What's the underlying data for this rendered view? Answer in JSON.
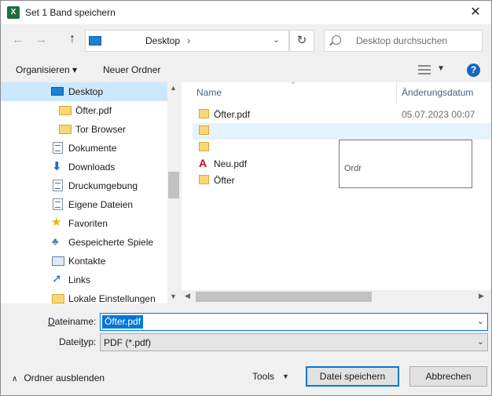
{
  "window": {
    "title": "Set 1 Band speichern",
    "app_icon_letter": "X",
    "close_glyph": "✕"
  },
  "nav": {
    "back_glyph": "←",
    "forward_glyph": "→",
    "up_glyph": "↑",
    "address": {
      "location": "Desktop",
      "separator": "›",
      "dropdown_glyph": "⌄"
    },
    "refresh_glyph": "↻",
    "search_placeholder": "Desktop durchsuchen"
  },
  "toolbar": {
    "organize": "Organisieren ▾",
    "new_folder": "Neuer Ordner",
    "view_dropdown": "▼",
    "help": "?"
  },
  "sidebar": {
    "items": [
      {
        "label": "Desktop",
        "icon": "desktop-icon",
        "selected": true
      },
      {
        "label": "Öfter.pdf",
        "icon": "folder-icon"
      },
      {
        "label": "Tor Browser",
        "icon": "folder-icon"
      },
      {
        "label": "Dokumente",
        "icon": "document-icon"
      },
      {
        "label": "Downloads",
        "icon": "download-icon"
      },
      {
        "label": "Druckumgebung",
        "icon": "document-icon"
      },
      {
        "label": "Eigene Dateien",
        "icon": "document-icon"
      },
      {
        "label": "Favoriten",
        "icon": "star-icon"
      },
      {
        "label": "Gespeicherte Spiele",
        "icon": "game-icon"
      },
      {
        "label": "Kontakte",
        "icon": "contact-icon"
      },
      {
        "label": "Links",
        "icon": "link-icon"
      },
      {
        "label": "Lokale Einstellungen",
        "icon": "folder-icon"
      }
    ]
  },
  "files": {
    "columns": {
      "name": "Name",
      "modified": "Änderungsdatum"
    },
    "rows": [
      {
        "name": "Öfter.pdf",
        "date": "05.07.2023 00:07",
        "icon": "folder-icon"
      },
      {
        "name": "",
        "date": "",
        "icon": "folder-icon"
      },
      {
        "name": "",
        "date": "",
        "icon": "folder-icon"
      },
      {
        "name": "Neu.pdf",
        "date": "",
        "icon": "pdf-icon"
      },
      {
        "name": "Öfter",
        "date": "",
        "icon": "folder-icon"
      }
    ],
    "tooltip_text": "Ordr"
  },
  "form": {
    "filename_label": "Dateiname:",
    "filename_label_accel": "D",
    "filename_label_rest": "ateiname:",
    "filename_value": "Öfter.pdf",
    "filetype_label": "Dateityp:",
    "filetype_label_accel": "t",
    "filetype_label_pre": "Datei",
    "filetype_label_rest": "yp:",
    "filetype_value": "PDF (*.pdf)"
  },
  "footer": {
    "hide_folders": "Ordner ausblenden",
    "tools": "Tools",
    "save": "Datei speichern",
    "cancel": "Abbrechen"
  }
}
